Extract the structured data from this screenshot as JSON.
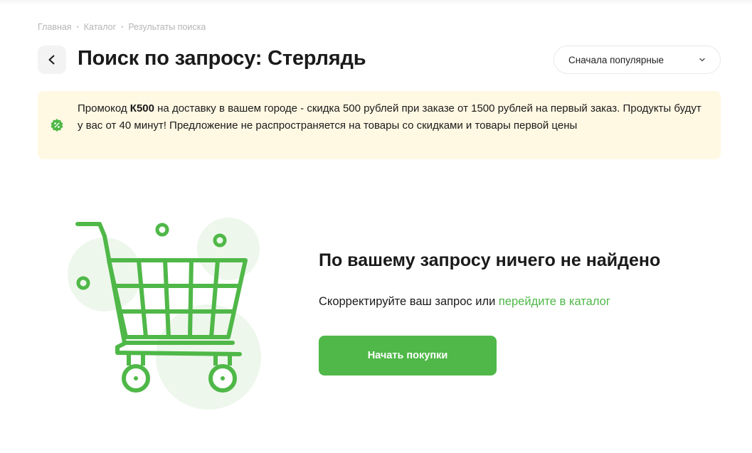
{
  "breadcrumb": {
    "items": [
      "Главная",
      "Каталог",
      "Результаты поиска"
    ],
    "separator": "•"
  },
  "header": {
    "back_icon": "chevron-left-icon",
    "title": "Поиск по запросу: Стерлядь"
  },
  "sort": {
    "selected": "Сначала популярные",
    "icon": "chevron-down-icon"
  },
  "promo": {
    "icon": "discount-badge-icon",
    "prefix": "Промокод ",
    "code": "К500",
    "text": " на доставку в вашем городе - скидка 500 рублей при заказе от 1500 рублей на первый заказ. Продукты будут у вас от 40 минут! Предложение не распространяется на товары со скидками и товары первой цены",
    "background": "#fff8e3",
    "accent": "#4fb848"
  },
  "empty_state": {
    "illustration": "shopping-cart-icon",
    "title": "По вашему запросу ничего не найдено",
    "hint_text": "Скорректируйте ваш запрос или ",
    "hint_link": "перейдите в каталог",
    "button_label": "Начать покупки"
  },
  "colors": {
    "brand_green": "#4fb848",
    "light_green": "#eef7ec",
    "text": "#1a1a1a",
    "muted": "#b5b5b5"
  }
}
